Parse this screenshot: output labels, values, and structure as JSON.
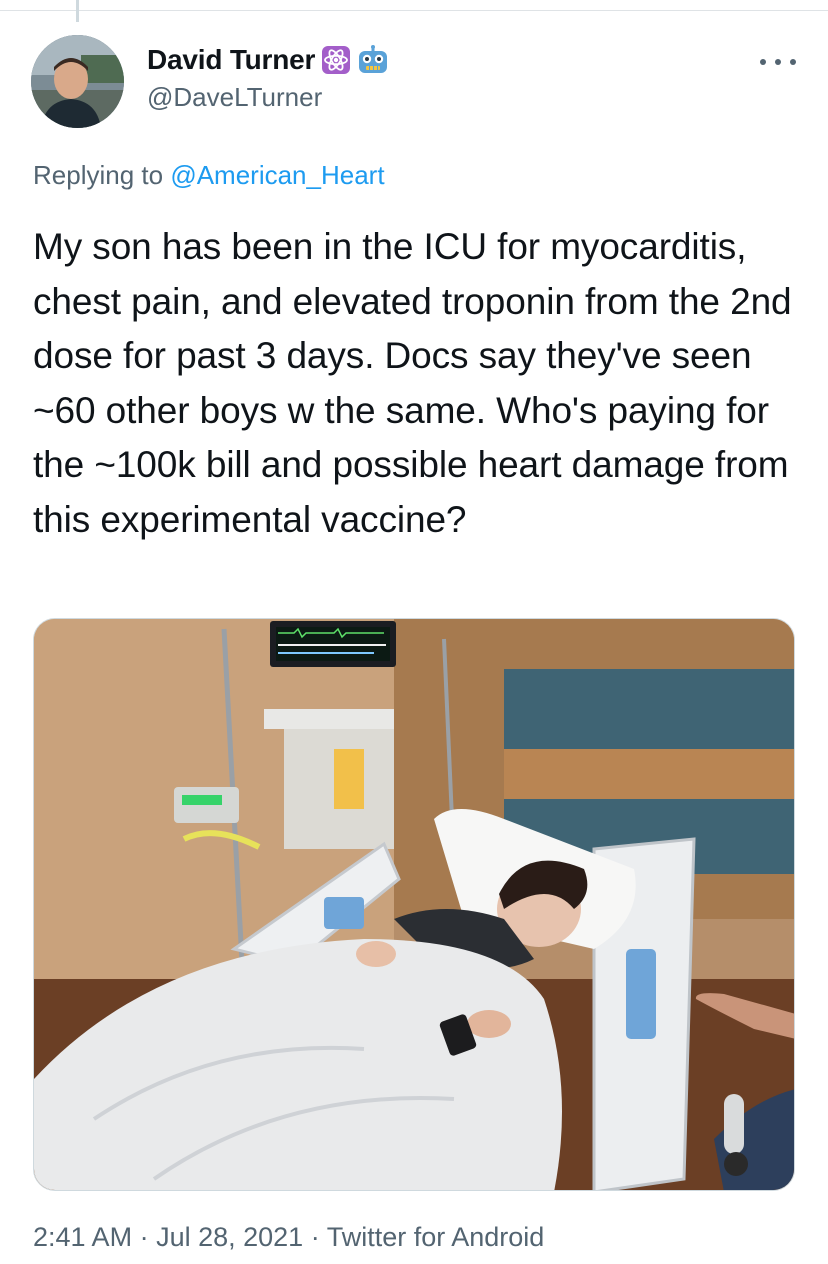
{
  "author": {
    "display_name": "David Turner",
    "handle": "@DaveLTurner",
    "badges": [
      "atom-emoji-icon",
      "robot-emoji-icon"
    ]
  },
  "reply": {
    "prefix": "Replying to ",
    "target": "@American_Heart"
  },
  "tweet": {
    "text": "My son has been in the ICU for myocarditis, chest pain, and elevated troponin from the 2nd dose for past 3 days. Docs say they've seen ~60 other boys w the same. Who's paying for the ~100k bill and possible heart damage from this experimental vaccine?"
  },
  "meta": {
    "time": "2:41 AM",
    "separator": " · ",
    "date": "Jul 28, 2021",
    "source": "Twitter for Android"
  },
  "colors": {
    "link": "#1d9bf0",
    "secondary_text": "#536471",
    "primary_text": "#0f1419",
    "atom_badge": "#a35ec9",
    "robot_badge": "#5aa2d8"
  }
}
